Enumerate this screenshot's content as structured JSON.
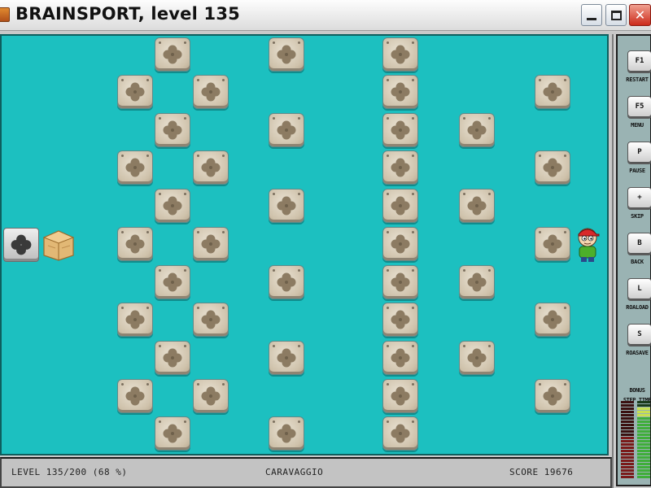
{
  "window": {
    "title": "BRAINSPORT, level 135",
    "minimize_icon": "minimize-icon",
    "maximize_icon": "maximize-icon",
    "close_icon": "close-icon"
  },
  "status_bar": {
    "level": "LEVEL 135/200 (68 %)",
    "painter": "CARAVAGGIO",
    "score": "SCORE 19676"
  },
  "controls": [
    {
      "key": "F1",
      "label": "RESTART"
    },
    {
      "key": "F5",
      "label": "MENU"
    },
    {
      "key": "P",
      "label": "PAUSE"
    },
    {
      "key": "+",
      "label": "SKIP"
    },
    {
      "key": "B",
      "label": "BACK"
    },
    {
      "key": "L",
      "label": "ROALOAD"
    },
    {
      "key": "S",
      "label": "ROASAVE"
    }
  ],
  "bonus": {
    "title": "BONUS",
    "step_label": "STEP",
    "time_label": "TIME",
    "step_level": 0.55,
    "time_level": 0.9
  },
  "board": {
    "background": "#1cc0c0",
    "tile_icon": "clover-icon",
    "target_icon": "clover-target-icon",
    "crate_icon": "crate-icon",
    "player_icon": "player-icon"
  }
}
